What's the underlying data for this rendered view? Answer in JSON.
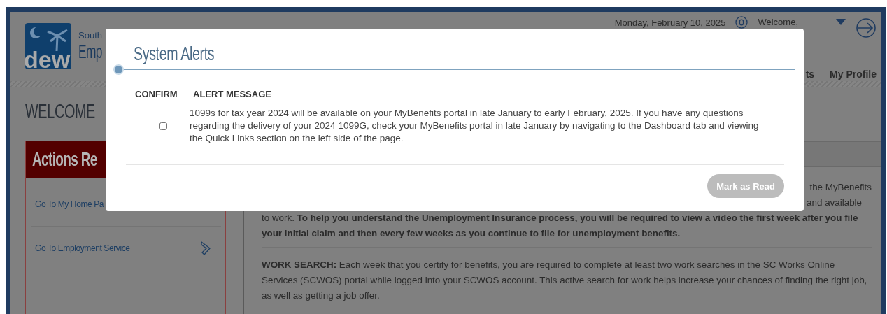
{
  "header": {
    "logo_text": "dew",
    "agency_line": "South",
    "title": "Emp",
    "date": "Monday, February 10, 2025",
    "welcome": "Welcome,"
  },
  "nav": [
    {
      "label": "ts"
    },
    {
      "label": "My Profile"
    }
  ],
  "page_title": "WELCOME",
  "sidebar": {
    "title": "Actions Re",
    "items": [
      {
        "label": "Go To My Home Pa"
      },
      {
        "label": "Go To Employment Service",
        "has_arrow": true
      }
    ]
  },
  "content": {
    "fragments": [
      "the MyBenefits",
      "and available"
    ],
    "paragraphs": [
      "to work. **To help you understand the Unemployment Insurance process, you will be required to view a video the first week after you file your initial claim and then every few weeks as you continue to file for unemployment benefits.**",
      "**WORK SEARCH:** Each week that you certify for benefits, you are required to complete at least two work searches in the SC Works Online Services (SCWOS) portal while logged into your SCWOS account. This active search for work helps increase your chances of finding the right job, as well as getting a job offer."
    ]
  },
  "modal": {
    "title": "System Alerts",
    "columns": [
      "CONFIRM",
      "ALERT MESSAGE"
    ],
    "alerts": [
      {
        "checked": false,
        "message": "1099s for tax year 2024 will be available on your MyBenefits portal in late January to early February, 2025. If you have any questions regarding the delivery of your 2024 1099G, check your MyBenefits portal in late January by navigating to the Dashboard tab and viewing the Quick Links section on the left side of the page."
      }
    ],
    "button": {
      "label": "Mark as Read",
      "disabled": true
    }
  }
}
